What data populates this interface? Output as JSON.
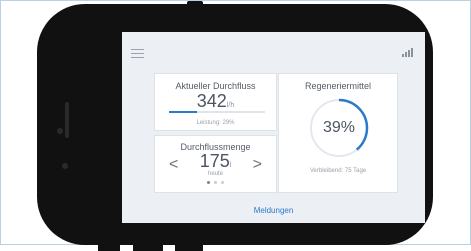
{
  "flow_card": {
    "title": "Aktueller Durchfluss",
    "value": "342",
    "unit": "l/h",
    "power_label": "Leistung: 29%",
    "power_fraction": 0.29
  },
  "volume_card": {
    "title": "Durchflussmenge",
    "value": "175",
    "unit": "l",
    "period": "heute",
    "left_arrow": "<",
    "right_arrow": ">",
    "page_count": 3,
    "active_page": 1
  },
  "regen_card": {
    "title": "Regeneriermittel",
    "percent_label": "39%",
    "percent": 39,
    "remaining": "Verbleibend: 75 Tage"
  },
  "footer": {
    "messages_link": "Meldungen"
  },
  "icons": {
    "menu": "hamburger-menu-icon",
    "signal": "signal-strength-icon"
  },
  "colors": {
    "accent": "#2a7ac7",
    "screen_bg": "#eceff4",
    "device": "#111111"
  }
}
